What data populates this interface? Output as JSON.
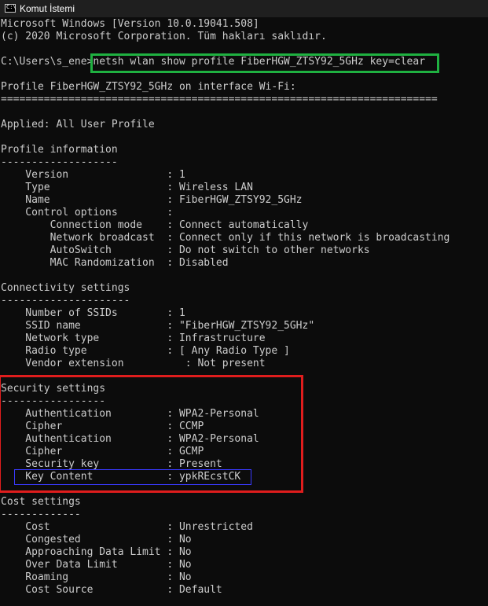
{
  "window": {
    "title": "Komut İstemi",
    "icon": "console-icon",
    "icon_glyph": "C:\\"
  },
  "console": {
    "lines": [
      "Microsoft Windows [Version 10.0.19041.508]",
      "(c) 2020 Microsoft Corporation. Tüm hakları saklıdır.",
      "",
      "C:\\Users\\s_ene>netsh wlan show profile FiberHGW_ZTSY92_5GHz key=clear",
      "",
      "Profile FiberHGW_ZTSY92_5GHz on interface Wi-Fi:",
      "=======================================================================",
      "",
      "Applied: All User Profile",
      "",
      "Profile information",
      "-------------------",
      "    Version                : 1",
      "    Type                   : Wireless LAN",
      "    Name                   : FiberHGW_ZTSY92_5GHz",
      "    Control options        :",
      "        Connection mode    : Connect automatically",
      "        Network broadcast  : Connect only if this network is broadcasting",
      "        AutoSwitch         : Do not switch to other networks",
      "        MAC Randomization  : Disabled",
      "",
      "Connectivity settings",
      "---------------------",
      "    Number of SSIDs        : 1",
      "    SSID name              : \"FiberHGW_ZTSY92_5GHz\"",
      "    Network type           : Infrastructure",
      "    Radio type             : [ Any Radio Type ]",
      "    Vendor extension          : Not present",
      "",
      "Security settings",
      "-----------------",
      "    Authentication         : WPA2-Personal",
      "    Cipher                 : CCMP",
      "    Authentication         : WPA2-Personal",
      "    Cipher                 : GCMP",
      "    Security key           : Present",
      "    Key Content            : ypkREcstCK",
      "",
      "Cost settings",
      "-------------",
      "    Cost                   : Unrestricted",
      "    Congested              : No",
      "    Approaching Data Limit : No",
      "    Over Data Limit        : No",
      "    Roaming                : No",
      "    Cost Source            : Default"
    ]
  },
  "colors": {
    "background": "#0c0c0c",
    "text": "#cccccc",
    "highlight_command": "#1fb141",
    "highlight_security": "#e01d1d",
    "highlight_key": "#3a3aff"
  }
}
